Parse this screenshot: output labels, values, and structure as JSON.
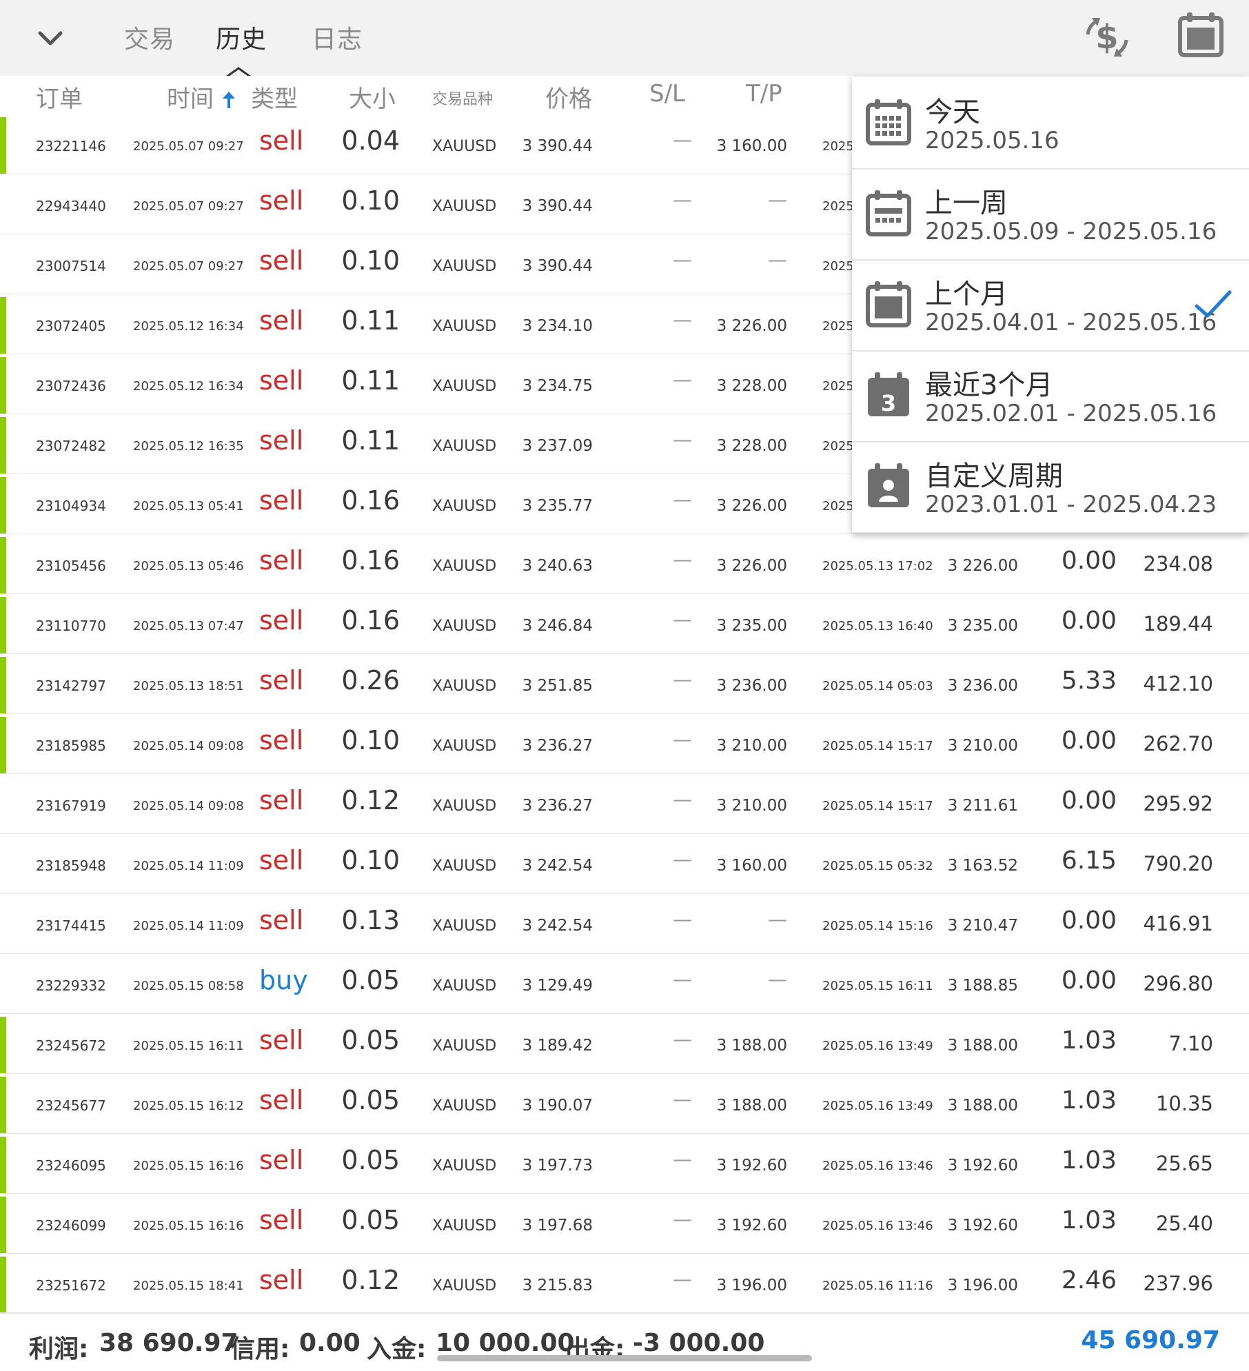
{
  "tabs": {
    "trade": "交易",
    "history": "历史",
    "journal": "日志"
  },
  "columns": {
    "order": "订单",
    "time": "时间",
    "type": "类型",
    "size": "大小",
    "symbol": "交易品种",
    "price": "价格",
    "sl": "S/L",
    "tp": "T/P"
  },
  "colors": {
    "sell": "#cc2a2a",
    "buy": "#1f7cd3",
    "marker_green": "#8ccc00",
    "balance": "#1f7cd3"
  },
  "icons": {
    "collapse": "chevron-down-icon",
    "currency": "currency-exchange-icon",
    "calendar": "calendar-icon",
    "sort": "arrow-up-icon",
    "selected": "checkmark-icon"
  },
  "rows": [
    {
      "marker": true,
      "order": "23221146",
      "time": "2025.05.07 09:27",
      "type": "sell",
      "size": "0.04",
      "symbol": "XAUUSD",
      "price": "3 390.44",
      "sl": "—",
      "tp": "3 160.00",
      "close_time": "2025.",
      "close_price": "",
      "swap": "",
      "profit": ""
    },
    {
      "marker": false,
      "order": "22943440",
      "time": "2025.05.07 09:27",
      "type": "sell",
      "size": "0.10",
      "symbol": "XAUUSD",
      "price": "3 390.44",
      "sl": "—",
      "tp": "—",
      "close_time": "2025.",
      "close_price": "",
      "swap": "",
      "profit": ""
    },
    {
      "marker": false,
      "order": "23007514",
      "time": "2025.05.07 09:27",
      "type": "sell",
      "size": "0.10",
      "symbol": "XAUUSD",
      "price": "3 390.44",
      "sl": "—",
      "tp": "—",
      "close_time": "2025.",
      "close_price": "",
      "swap": "",
      "profit": ""
    },
    {
      "marker": true,
      "order": "23072405",
      "time": "2025.05.12 16:34",
      "type": "sell",
      "size": "0.11",
      "symbol": "XAUUSD",
      "price": "3 234.10",
      "sl": "—",
      "tp": "3 226.00",
      "close_time": "2025.",
      "close_price": "",
      "swap": "",
      "profit": ""
    },
    {
      "marker": true,
      "order": "23072436",
      "time": "2025.05.12 16:34",
      "type": "sell",
      "size": "0.11",
      "symbol": "XAUUSD",
      "price": "3 234.75",
      "sl": "—",
      "tp": "3 228.00",
      "close_time": "2025.",
      "close_price": "",
      "swap": "",
      "profit": ""
    },
    {
      "marker": true,
      "order": "23072482",
      "time": "2025.05.12 16:35",
      "type": "sell",
      "size": "0.11",
      "symbol": "XAUUSD",
      "price": "3 237.09",
      "sl": "—",
      "tp": "3 228.00",
      "close_time": "2025.",
      "close_price": "",
      "swap": "",
      "profit": ""
    },
    {
      "marker": true,
      "order": "23104934",
      "time": "2025.05.13 05:41",
      "type": "sell",
      "size": "0.16",
      "symbol": "XAUUSD",
      "price": "3 235.77",
      "sl": "—",
      "tp": "3 226.00",
      "close_time": "2025.",
      "close_price": "",
      "swap": "",
      "profit": ""
    },
    {
      "marker": true,
      "order": "23105456",
      "time": "2025.05.13 05:46",
      "type": "sell",
      "size": "0.16",
      "symbol": "XAUUSD",
      "price": "3 240.63",
      "sl": "—",
      "tp": "3 226.00",
      "close_time": "2025.05.13 17:02",
      "close_price": "3 226.00",
      "swap": "0.00",
      "profit": "234.08"
    },
    {
      "marker": true,
      "order": "23110770",
      "time": "2025.05.13 07:47",
      "type": "sell",
      "size": "0.16",
      "symbol": "XAUUSD",
      "price": "3 246.84",
      "sl": "—",
      "tp": "3 235.00",
      "close_time": "2025.05.13 16:40",
      "close_price": "3 235.00",
      "swap": "0.00",
      "profit": "189.44"
    },
    {
      "marker": true,
      "order": "23142797",
      "time": "2025.05.13 18:51",
      "type": "sell",
      "size": "0.26",
      "symbol": "XAUUSD",
      "price": "3 251.85",
      "sl": "—",
      "tp": "3 236.00",
      "close_time": "2025.05.14 05:03",
      "close_price": "3 236.00",
      "swap": "5.33",
      "profit": "412.10"
    },
    {
      "marker": true,
      "order": "23185985",
      "time": "2025.05.14 09:08",
      "type": "sell",
      "size": "0.10",
      "symbol": "XAUUSD",
      "price": "3 236.27",
      "sl": "—",
      "tp": "3 210.00",
      "close_time": "2025.05.14 15:17",
      "close_price": "3 210.00",
      "swap": "0.00",
      "profit": "262.70"
    },
    {
      "marker": false,
      "order": "23167919",
      "time": "2025.05.14 09:08",
      "type": "sell",
      "size": "0.12",
      "symbol": "XAUUSD",
      "price": "3 236.27",
      "sl": "—",
      "tp": "3 210.00",
      "close_time": "2025.05.14 15:17",
      "close_price": "3 211.61",
      "swap": "0.00",
      "profit": "295.92"
    },
    {
      "marker": false,
      "order": "23185948",
      "time": "2025.05.14 11:09",
      "type": "sell",
      "size": "0.10",
      "symbol": "XAUUSD",
      "price": "3 242.54",
      "sl": "—",
      "tp": "3 160.00",
      "close_time": "2025.05.15 05:32",
      "close_price": "3 163.52",
      "swap": "6.15",
      "profit": "790.20"
    },
    {
      "marker": false,
      "order": "23174415",
      "time": "2025.05.14 11:09",
      "type": "sell",
      "size": "0.13",
      "symbol": "XAUUSD",
      "price": "3 242.54",
      "sl": "—",
      "tp": "—",
      "close_time": "2025.05.14 15:16",
      "close_price": "3 210.47",
      "swap": "0.00",
      "profit": "416.91"
    },
    {
      "marker": false,
      "order": "23229332",
      "time": "2025.05.15 08:58",
      "type": "buy",
      "size": "0.05",
      "symbol": "XAUUSD",
      "price": "3 129.49",
      "sl": "—",
      "tp": "—",
      "close_time": "2025.05.15 16:11",
      "close_price": "3 188.85",
      "swap": "0.00",
      "profit": "296.80"
    },
    {
      "marker": true,
      "order": "23245672",
      "time": "2025.05.15 16:11",
      "type": "sell",
      "size": "0.05",
      "symbol": "XAUUSD",
      "price": "3 189.42",
      "sl": "—",
      "tp": "3 188.00",
      "close_time": "2025.05.16 13:49",
      "close_price": "3 188.00",
      "swap": "1.03",
      "profit": "7.10"
    },
    {
      "marker": true,
      "order": "23245677",
      "time": "2025.05.15 16:12",
      "type": "sell",
      "size": "0.05",
      "symbol": "XAUUSD",
      "price": "3 190.07",
      "sl": "—",
      "tp": "3 188.00",
      "close_time": "2025.05.16 13:49",
      "close_price": "3 188.00",
      "swap": "1.03",
      "profit": "10.35"
    },
    {
      "marker": true,
      "order": "23246095",
      "time": "2025.05.15 16:16",
      "type": "sell",
      "size": "0.05",
      "symbol": "XAUUSD",
      "price": "3 197.73",
      "sl": "—",
      "tp": "3 192.60",
      "close_time": "2025.05.16 13:46",
      "close_price": "3 192.60",
      "swap": "1.03",
      "profit": "25.65"
    },
    {
      "marker": true,
      "order": "23246099",
      "time": "2025.05.15 16:16",
      "type": "sell",
      "size": "0.05",
      "symbol": "XAUUSD",
      "price": "3 197.68",
      "sl": "—",
      "tp": "3 192.60",
      "close_time": "2025.05.16 13:46",
      "close_price": "3 192.60",
      "swap": "1.03",
      "profit": "25.40"
    },
    {
      "marker": true,
      "order": "23251672",
      "time": "2025.05.15 18:41",
      "type": "sell",
      "size": "0.12",
      "symbol": "XAUUSD",
      "price": "3 215.83",
      "sl": "—",
      "tp": "3 196.00",
      "close_time": "2025.05.16 11:16",
      "close_price": "3 196.00",
      "swap": "2.46",
      "profit": "237.96"
    }
  ],
  "period_menu": [
    {
      "title": "今天",
      "range": "2025.05.16",
      "icon": "calendar-grid-icon",
      "selected": false
    },
    {
      "title": "上一周",
      "range": "2025.05.09 - 2025.05.16",
      "icon": "calendar-week-icon",
      "selected": false
    },
    {
      "title": "上个月",
      "range": "2025.04.01 - 2025.05.16",
      "icon": "calendar-month-icon",
      "selected": true
    },
    {
      "title": "最近3个月",
      "range": "2025.02.01 - 2025.05.16",
      "icon": "calendar-3-icon",
      "icon_text": "3",
      "selected": false
    },
    {
      "title": "自定义周期",
      "range": "2023.01.01 - 2025.04.23",
      "icon": "calendar-person-icon",
      "selected": false
    }
  ],
  "footer": {
    "profit_label": "利润:",
    "profit": "38 690.97",
    "credit_label": "信用:",
    "credit": "0.00",
    "deposit_label": "入金:",
    "deposit": "10 000.00",
    "withdrawal_label": "出金:",
    "withdrawal": "-3 000.00",
    "balance": "45 690.97"
  }
}
